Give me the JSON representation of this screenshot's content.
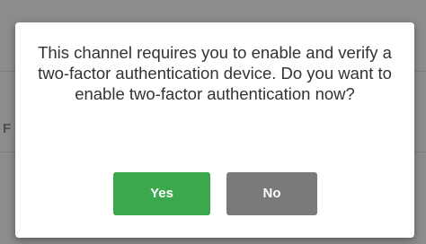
{
  "background": {
    "letter": "F"
  },
  "dialog": {
    "message": "This channel requires you to enable and verify a two-factor authentication device. Do you want to enable two-factor authentication now?",
    "yes_label": "Yes",
    "no_label": "No"
  },
  "colors": {
    "yes_button": "#3ba84d",
    "no_button": "#7a7a7a",
    "overlay": "#8c8c8c"
  }
}
